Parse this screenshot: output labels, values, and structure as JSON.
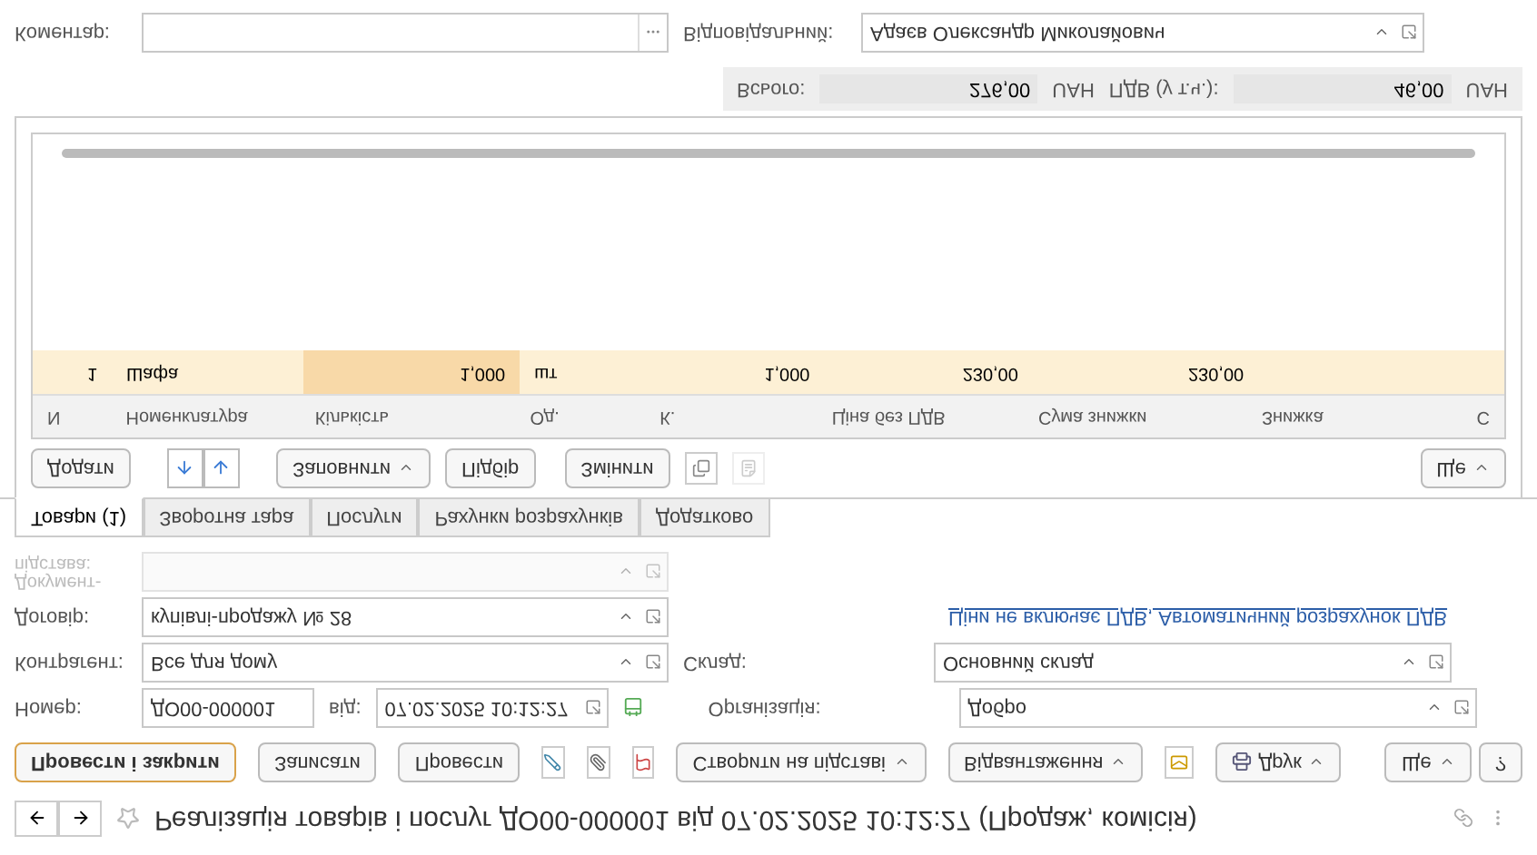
{
  "window": {
    "title": "Реалізація товарів і послуг ДО00-000001 від 07.02.2025 10:12:27 (Продаж, комісія)"
  },
  "command_bar": {
    "buttons": [
      {
        "label": "Провести і закрити",
        "kind": "primary"
      },
      {
        "label": "Записати",
        "kind": "plain"
      },
      {
        "label": "Провести",
        "kind": "plain"
      },
      {
        "label": "Створити на підставі",
        "kind": "menu"
      },
      {
        "label": "Відвантаження",
        "kind": "menu"
      },
      {
        "label": "Друк",
        "kind": "print"
      }
    ],
    "more": "Ще",
    "help": "?"
  },
  "header": {
    "number_label": "Номер:",
    "number": "ДО00-000001",
    "date_label": "від:",
    "date": "07.02.2025 10:12:27",
    "organization_label": "Організація:",
    "organization": "Добро",
    "counterparty_label": "Контрагент:",
    "counterparty": "Все для дому",
    "warehouse_label": "Склад:",
    "warehouse": "Основний склад",
    "contract_label": "Договір:",
    "contract": "купівлі-продажу № 28",
    "vat_link": "Ціни не включає ПДВ, Автоматичний розрахунок ПДВ",
    "basis_label": "Документ-підстава:",
    "basis_disabled": true
  },
  "tabs": [
    {
      "label": "Товари (1)",
      "selected": true
    },
    {
      "label": "Зворотна тара",
      "selected": false
    },
    {
      "label": "Послуги",
      "selected": false
    },
    {
      "label": "Рахунки розрахунків",
      "selected": false
    },
    {
      "label": "Додатково",
      "selected": false
    }
  ],
  "table_toolbar": {
    "add": "Додати",
    "fill": "Заповнити",
    "pick": "Підбір",
    "change": "Змінити",
    "more": "Ще"
  },
  "table": {
    "rows": [
      {
        "cells": [
          "1",
          "Шафа",
          "1,000",
          "шт",
          "1,000",
          "230,00",
          "230,00",
          "",
          ""
        ],
        "selected": true
      }
    ]
  },
  "table_header": {
    "labels": [
      "N",
      "Номенклатура",
      "Кількість",
      "Од.",
      "К.",
      "Ціна без ПДВ",
      "Сума знижки",
      "Знижка",
      "С"
    ]
  },
  "totals": {
    "total_label": "Всього:",
    "total": "276,00",
    "total_currency": "UAH",
    "vat_label": "ПДВ (у т.ч.):",
    "vat": "46,00",
    "vat_currency": "UAH"
  },
  "footer": {
    "comment_label": "Коментар:",
    "responsible_label": "Відповідальний:",
    "responsible": "Адаєв Олександр Миколайович"
  }
}
